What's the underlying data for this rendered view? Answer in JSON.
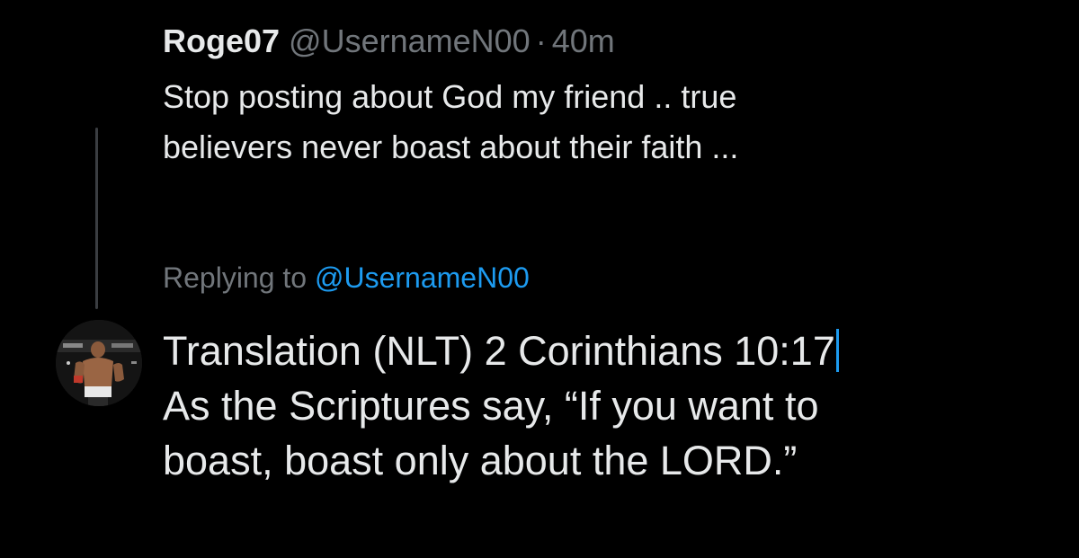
{
  "parent_tweet": {
    "display_name": "Roge07",
    "handle": "@UsernameN00",
    "separator": "·",
    "time": "40m",
    "text_line1": "Stop posting about God my friend .. true",
    "text_line2": "believers never boast about their faith ..."
  },
  "reply": {
    "replying_label": "Replying to ",
    "replying_handle": "@UsernameN00",
    "text_line1": "Translation (NLT) 2 Corinthians 10:17",
    "text_line2": "As the Scriptures say, “If you want to",
    "text_line3": "boast, boast only about the LORD.”"
  },
  "colors": {
    "background": "#000000",
    "primary_text": "#e7e9ea",
    "secondary_text": "#71767b",
    "accent": "#1d9bf0",
    "thread_line": "#3a3d41"
  }
}
